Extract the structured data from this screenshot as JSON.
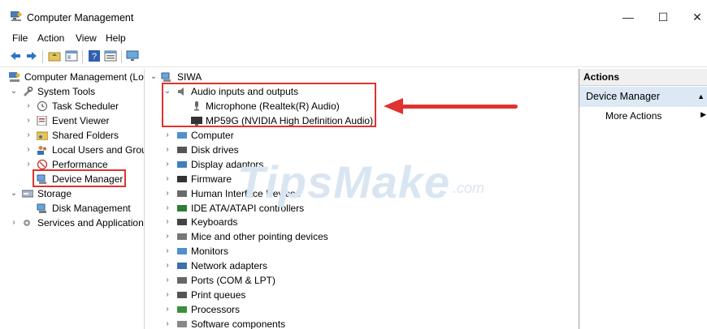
{
  "window": {
    "title": "Computer Management"
  },
  "menu": [
    "File",
    "Action",
    "View",
    "Help"
  ],
  "watermark": {
    "brand": "TipsMake",
    "suffix": ".com"
  },
  "left_tree": [
    {
      "label": "Computer Management (Lo",
      "expander": "",
      "level": 0
    },
    {
      "label": "System Tools",
      "expander": "⌄",
      "level": 1
    },
    {
      "label": "Task Scheduler",
      "expander": "›",
      "level": 2
    },
    {
      "label": "Event Viewer",
      "expander": "›",
      "level": 2
    },
    {
      "label": "Shared Folders",
      "expander": "›",
      "level": 2
    },
    {
      "label": "Local Users and Grou",
      "expander": "›",
      "level": 2
    },
    {
      "label": "Performance",
      "expander": "›",
      "level": 2
    },
    {
      "label": "Device Manager",
      "expander": "",
      "level": 2,
      "selected": true
    },
    {
      "label": "Storage",
      "expander": "⌄",
      "level": 1
    },
    {
      "label": "Disk Management",
      "expander": "",
      "level": 2
    },
    {
      "label": "Services and Application",
      "expander": "›",
      "level": 1
    }
  ],
  "device_tree": {
    "root": "SIWA",
    "audio_category": "Audio inputs and outputs",
    "audio_children": [
      "Microphone (Realtek(R) Audio)",
      "MP59G (NVIDIA High Definition Audio)"
    ],
    "categories": [
      "Computer",
      "Disk drives",
      "Display adaptors",
      "Firmware",
      "Human Interface Devices",
      "IDE ATA/ATAPI controllers",
      "Keyboards",
      "Mice and other pointing devices",
      "Monitors",
      "Network adapters",
      "Ports (COM & LPT)",
      "Print queues",
      "Processors",
      "Software components"
    ]
  },
  "actions": {
    "header": "Actions",
    "group": "Device Manager",
    "more": "More Actions"
  },
  "colors": {
    "highlight": "#e0322f",
    "actions_group_bg": "#dce9f5"
  }
}
